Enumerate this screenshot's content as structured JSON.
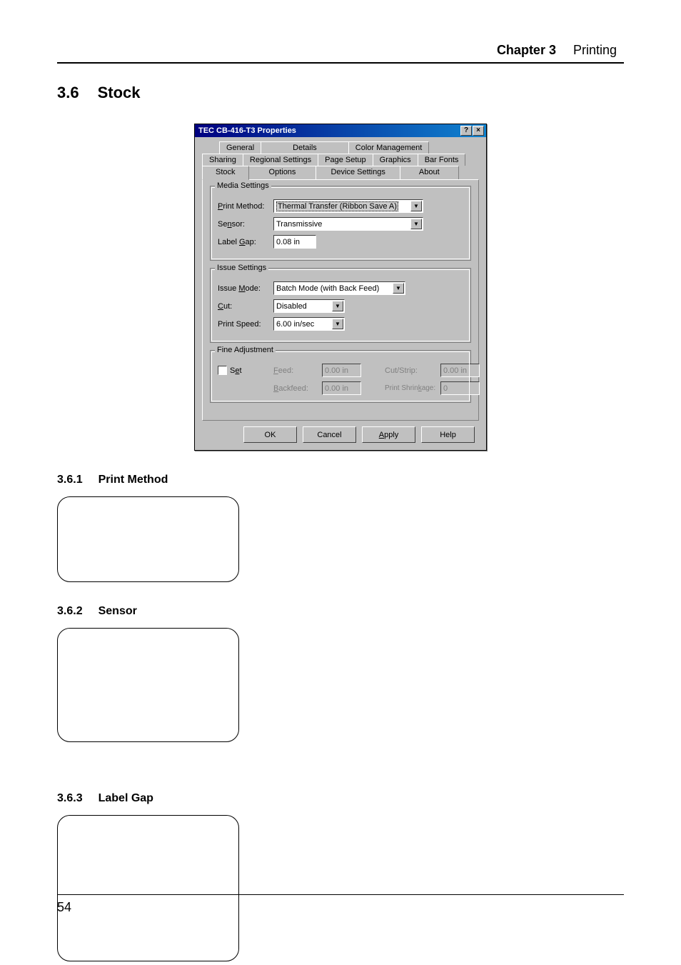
{
  "header": {
    "chapter_label": "Chapter 3",
    "chapter_page_title": "Printing"
  },
  "section": {
    "number": "3.6",
    "title": "Stock"
  },
  "subsections": {
    "s1": {
      "num": "3.6.1",
      "title": "Print Method"
    },
    "s2": {
      "num": "3.6.2",
      "title": "Sensor"
    },
    "s3": {
      "num": "3.6.3",
      "title": "Label Gap"
    }
  },
  "dialog": {
    "title": "TEC CB-416-T3 Properties",
    "help_btn": "?",
    "close_btn": "×",
    "tabs_row1": [
      "General",
      "Details",
      "Color Management"
    ],
    "tabs_row2": [
      "Sharing",
      "Regional Settings",
      "Page Setup",
      "Graphics",
      "Bar Fonts"
    ],
    "tabs_row3": [
      "Stock",
      "Options",
      "Device Settings",
      "About"
    ],
    "groups": {
      "media": {
        "legend": "Media Settings",
        "print_method_label": "Print Method:",
        "print_method_value": "Thermal Transfer (Ribbon Save A)",
        "sensor_label": "Sensor:",
        "sensor_value": "Transmissive",
        "label_gap_label": "Label Gap:",
        "label_gap_value": "0.08 in"
      },
      "issue": {
        "legend": "Issue Settings",
        "issue_mode_label": "Issue Mode:",
        "issue_mode_value": "Batch Mode (with Back Feed)",
        "cut_label": "Cut:",
        "cut_value": "Disabled",
        "print_speed_label": "Print Speed:",
        "print_speed_value": "6.00 in/sec"
      },
      "fine": {
        "legend": "Fine Adjustment",
        "set_label": "Set",
        "feed_label": "Feed:",
        "feed_value": "0.00 in",
        "cutstrip_label": "Cut/Strip:",
        "cutstrip_value": "0.00 in",
        "backfeed_label": "Backfeed:",
        "backfeed_value": "0.00 in",
        "shrinkage_label": "Print Shrinkage:",
        "shrinkage_value": "0"
      }
    },
    "buttons": {
      "ok": "OK",
      "cancel": "Cancel",
      "apply": "Apply",
      "help": "Help"
    }
  },
  "page_number": "54"
}
